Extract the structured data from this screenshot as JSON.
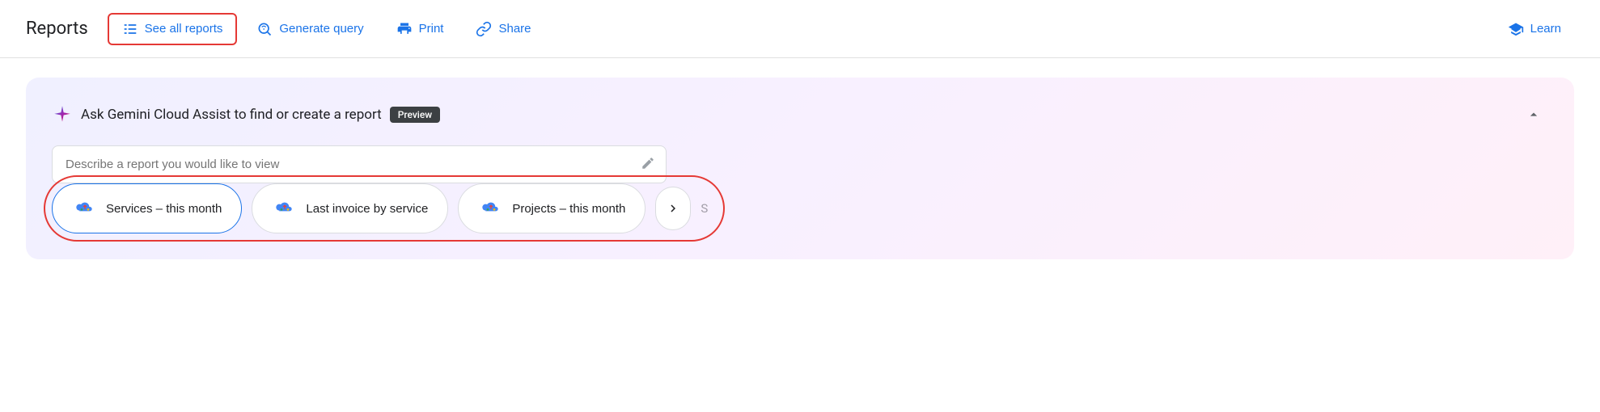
{
  "toolbar": {
    "title": "Reports",
    "see_all_reports_label": "See all reports",
    "generate_query_label": "Generate query",
    "print_label": "Print",
    "share_label": "Share",
    "learn_label": "Learn"
  },
  "gemini_panel": {
    "title": "Ask Gemini Cloud Assist to find or create a report",
    "preview_badge": "Preview",
    "input_placeholder": "Describe a report you would like to view",
    "quick_actions": [
      {
        "label": "Services – this month"
      },
      {
        "label": "Last invoice by service"
      },
      {
        "label": "Projects – this month"
      }
    ],
    "next_arrow": "›"
  },
  "icons": {
    "list_icon": "☰",
    "search_icon": "🔍",
    "print_icon": "🖨",
    "share_icon": "🔗",
    "learn_icon": "🎓",
    "sparkle_icon": "✦",
    "chevron_up": "∧",
    "chevron_right": "›",
    "edit_icon": "✏"
  }
}
